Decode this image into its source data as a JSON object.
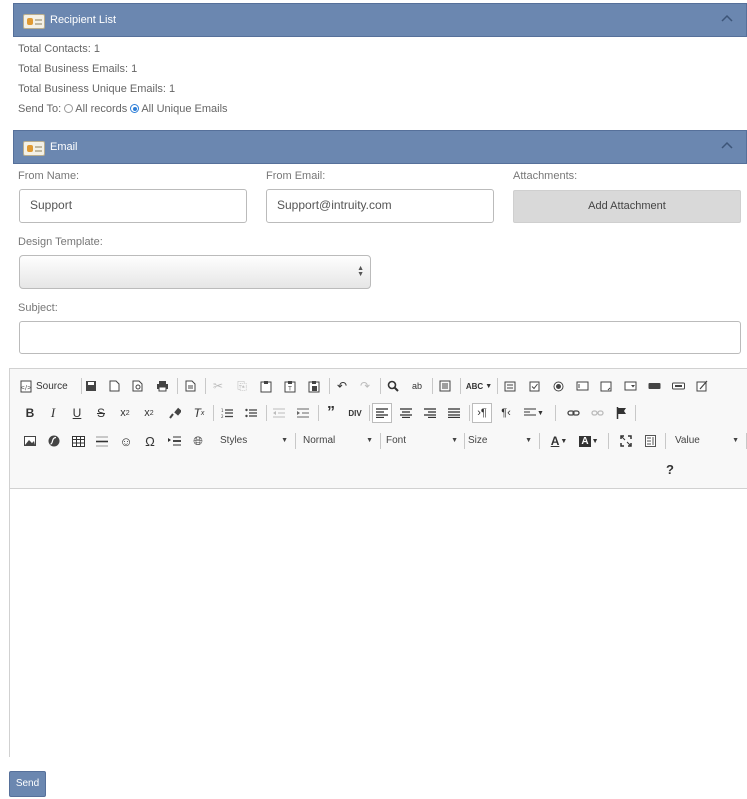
{
  "recipient_panel": {
    "title": "Recipient List",
    "total_contacts": "Total Contacts: 1",
    "total_business_emails": "Total Business Emails: 1",
    "total_business_unique_emails": "Total Business Unique Emails: 1",
    "send_to_label": "Send To:",
    "send_to_options": [
      "All records",
      "All Unique Emails"
    ],
    "send_to_selected": "All Unique Emails"
  },
  "email_panel": {
    "title": "Email",
    "from_name_label": "From Name:",
    "from_name_value": "Support",
    "from_email_label": "From Email:",
    "from_email_value": "Support@intruity.com",
    "attachments_label": "Attachments:",
    "add_attachment_label": "Add Attachment",
    "design_template_label": "Design Template:",
    "design_template_value": "",
    "subject_label": "Subject:",
    "subject_value": ""
  },
  "editor": {
    "source_label": "Source",
    "styles_label": "Styles",
    "format_label": "Normal",
    "font_label": "Font",
    "size_label": "Size",
    "value_label": "Value",
    "help_label": "?"
  },
  "send_label": "Send",
  "colors": {
    "header_bg": "#6b87b0",
    "button_bg": "#d9d9d9",
    "radio_selected": "#2f7fd8"
  }
}
